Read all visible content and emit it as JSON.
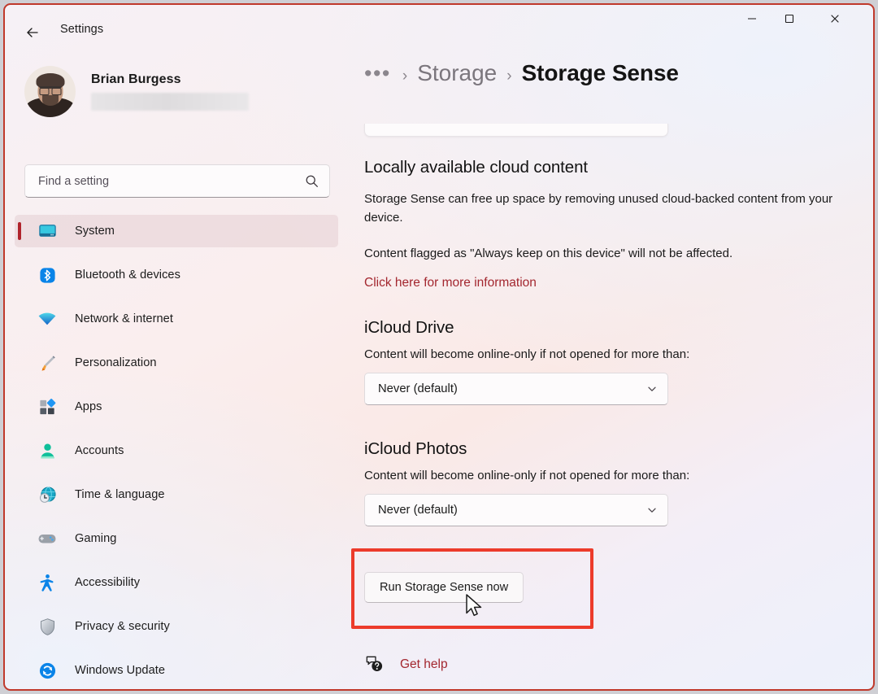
{
  "window": {
    "app_title": "Settings",
    "back_icon": "back-arrow-icon",
    "controls": {
      "minimize": "minimize-icon",
      "maximize": "maximize-icon",
      "close": "close-icon"
    },
    "border_color": "#c0392b"
  },
  "sidebar": {
    "profile": {
      "name": "Brian Burgess",
      "email_redacted": true
    },
    "search": {
      "placeholder": "Find a setting",
      "value": "",
      "icon": "search-icon"
    },
    "items": [
      {
        "label": "System",
        "icon": "monitor-icon",
        "active": true
      },
      {
        "label": "Bluetooth & devices",
        "icon": "bluetooth-icon",
        "active": false
      },
      {
        "label": "Network & internet",
        "icon": "wifi-icon",
        "active": false
      },
      {
        "label": "Personalization",
        "icon": "paintbrush-icon",
        "active": false
      },
      {
        "label": "Apps",
        "icon": "apps-grid-icon",
        "active": false
      },
      {
        "label": "Accounts",
        "icon": "person-icon",
        "active": false
      },
      {
        "label": "Time & language",
        "icon": "clock-globe-icon",
        "active": false
      },
      {
        "label": "Gaming",
        "icon": "gamepad-icon",
        "active": false
      },
      {
        "label": "Accessibility",
        "icon": "accessibility-icon",
        "active": false
      },
      {
        "label": "Privacy & security",
        "icon": "shield-icon",
        "active": false
      },
      {
        "label": "Windows Update",
        "icon": "update-sync-icon",
        "active": false
      }
    ],
    "active_accent_color": "#b0242c"
  },
  "main": {
    "breadcrumb": {
      "overflow": "•••",
      "separator": "›",
      "parent": "Storage",
      "current": "Storage Sense"
    },
    "cloud_section": {
      "heading": "Locally available cloud content",
      "description": "Storage Sense can free up space by removing unused cloud-backed content from your device.",
      "note": "Content flagged as \"Always keep on this device\" will not be affected.",
      "link": "Click here for more information",
      "link_color": "#a3272f"
    },
    "icloud_drive": {
      "heading": "iCloud Drive",
      "description": "Content will become online-only if not opened for more than:",
      "dropdown_value": "Never (default)",
      "dropdown_icon": "chevron-down-icon"
    },
    "icloud_photos": {
      "heading": "iCloud Photos",
      "description": "Content will become online-only if not opened for more than:",
      "dropdown_value": "Never (default)",
      "dropdown_icon": "chevron-down-icon"
    },
    "run_button": {
      "label": "Run Storage Sense now",
      "highlighted": true,
      "highlight_color": "#ec3b2b"
    },
    "help": {
      "label": "Get help",
      "icon": "help-bubble-icon",
      "color": "#a3272f"
    }
  }
}
